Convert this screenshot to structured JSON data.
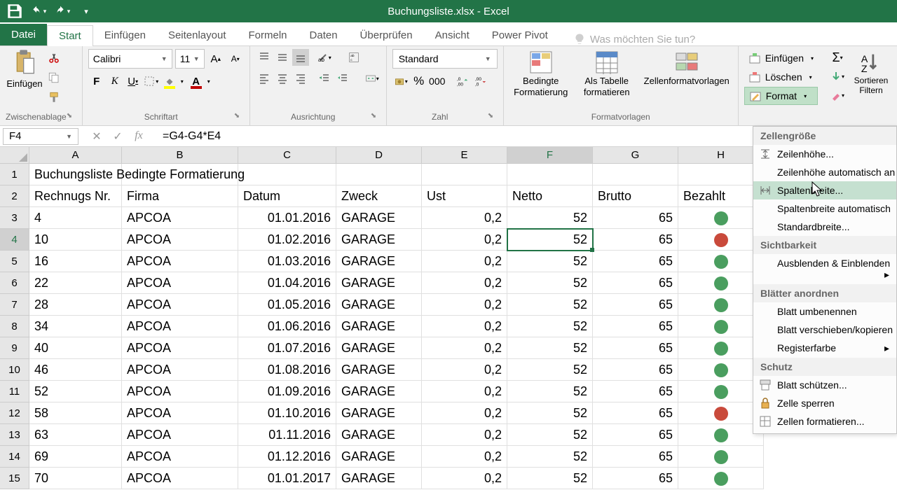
{
  "title": "Buchungsliste.xlsx - Excel",
  "tabs": {
    "file": "Datei",
    "home": "Start",
    "insert": "Einfügen",
    "pagelayout": "Seitenlayout",
    "formulas": "Formeln",
    "data": "Daten",
    "review": "Überprüfen",
    "view": "Ansicht",
    "powerpivot": "Power Pivot"
  },
  "tellme": "Was möchten Sie tun?",
  "ribbon": {
    "clipboard": {
      "paste": "Einfügen",
      "group": "Zwischenablage"
    },
    "font": {
      "name": "Calibri",
      "size": "11",
      "group": "Schriftart"
    },
    "alignment": {
      "group": "Ausrichtung"
    },
    "number": {
      "format": "Standard",
      "group": "Zahl"
    },
    "styles": {
      "condfmt": "Bedingte Formatierung",
      "table": "Als Tabelle formatieren",
      "cellstyles": "Zellenformatvorlagen",
      "group": "Formatvorlagen"
    },
    "cells": {
      "insert": "Einfügen",
      "delete": "Löschen",
      "format": "Format"
    },
    "editing": {
      "sort": "Sortieren Filtern"
    }
  },
  "namebox": "F4",
  "formula": "=G4-G4*E4",
  "columns": [
    "A",
    "B",
    "C",
    "D",
    "E",
    "F",
    "G",
    "H"
  ],
  "heading_row1": "Buchungsliste Bedingte Formatierung",
  "headers": {
    "A": "Rechnugs Nr.",
    "B": "Firma",
    "C": "Datum",
    "D": "Zweck",
    "E": "Ust",
    "F": "Netto",
    "G": "Brutto",
    "H": "Bezahlt"
  },
  "rows": [
    {
      "n": 3,
      "A": "4",
      "B": "APCOA",
      "C": "01.01.2016",
      "D": "GARAGE",
      "E": "0,2",
      "F": "52",
      "G": "65",
      "H": "green"
    },
    {
      "n": 4,
      "A": "10",
      "B": "APCOA",
      "C": "01.02.2016",
      "D": "GARAGE",
      "E": "0,2",
      "F": "52",
      "G": "65",
      "H": "red"
    },
    {
      "n": 5,
      "A": "16",
      "B": "APCOA",
      "C": "01.03.2016",
      "D": "GARAGE",
      "E": "0,2",
      "F": "52",
      "G": "65",
      "H": "green"
    },
    {
      "n": 6,
      "A": "22",
      "B": "APCOA",
      "C": "01.04.2016",
      "D": "GARAGE",
      "E": "0,2",
      "F": "52",
      "G": "65",
      "H": "green"
    },
    {
      "n": 7,
      "A": "28",
      "B": "APCOA",
      "C": "01.05.2016",
      "D": "GARAGE",
      "E": "0,2",
      "F": "52",
      "G": "65",
      "H": "green"
    },
    {
      "n": 8,
      "A": "34",
      "B": "APCOA",
      "C": "01.06.2016",
      "D": "GARAGE",
      "E": "0,2",
      "F": "52",
      "G": "65",
      "H": "green"
    },
    {
      "n": 9,
      "A": "40",
      "B": "APCOA",
      "C": "01.07.2016",
      "D": "GARAGE",
      "E": "0,2",
      "F": "52",
      "G": "65",
      "H": "green"
    },
    {
      "n": 10,
      "A": "46",
      "B": "APCOA",
      "C": "01.08.2016",
      "D": "GARAGE",
      "E": "0,2",
      "F": "52",
      "G": "65",
      "H": "green"
    },
    {
      "n": 11,
      "A": "52",
      "B": "APCOA",
      "C": "01.09.2016",
      "D": "GARAGE",
      "E": "0,2",
      "F": "52",
      "G": "65",
      "H": "green"
    },
    {
      "n": 12,
      "A": "58",
      "B": "APCOA",
      "C": "01.10.2016",
      "D": "GARAGE",
      "E": "0,2",
      "F": "52",
      "G": "65",
      "H": "red"
    },
    {
      "n": 13,
      "A": "63",
      "B": "APCOA",
      "C": "01.11.2016",
      "D": "GARAGE",
      "E": "0,2",
      "F": "52",
      "G": "65",
      "H": "green"
    },
    {
      "n": 14,
      "A": "69",
      "B": "APCOA",
      "C": "01.12.2016",
      "D": "GARAGE",
      "E": "0,2",
      "F": "52",
      "G": "65",
      "H": "green"
    },
    {
      "n": 15,
      "A": "70",
      "B": "APCOA",
      "C": "01.01.2017",
      "D": "GARAGE",
      "E": "0,2",
      "F": "52",
      "G": "65",
      "H": "green"
    }
  ],
  "menu": {
    "s1": "Zellengröße",
    "rowheight": "Zeilenhöhe...",
    "autorow": "Zeilenhöhe automatisch an",
    "colwidth": "Spaltenbreite...",
    "autocol": "Spaltenbreite automatisch",
    "default": "Standardbreite...",
    "s2": "Sichtbarkeit",
    "hide": "Ausblenden & Einblenden",
    "s3": "Blätter anordnen",
    "rename": "Blatt umbenennen",
    "move": "Blatt verschieben/kopieren",
    "tabcolor": "Registerfarbe",
    "s4": "Schutz",
    "protect": "Blatt schützen...",
    "lock": "Zelle sperren",
    "formatcells": "Zellen formatieren..."
  }
}
